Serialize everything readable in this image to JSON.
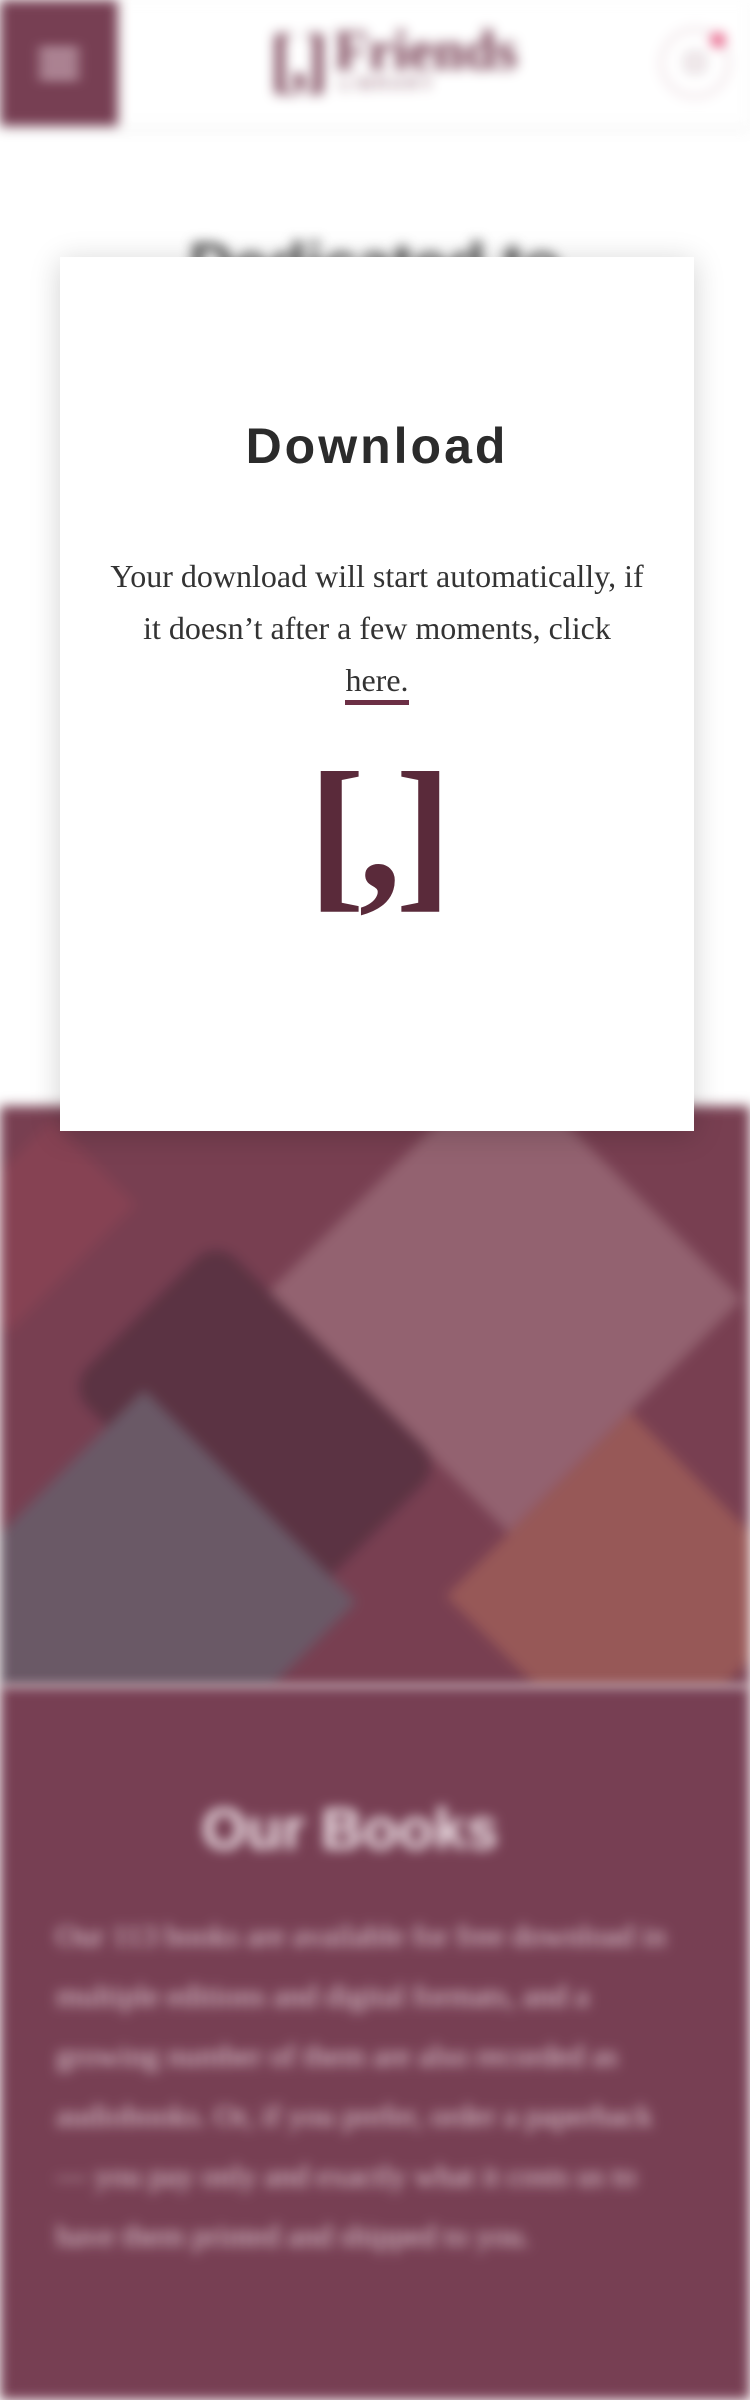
{
  "header": {
    "logo_mark": "[,]",
    "logo_name": "Friends",
    "logo_sub": "LIBRARY"
  },
  "background": {
    "partial_title": "Dedicated to the"
  },
  "modal": {
    "title": "Download",
    "message": "Your download will start automatically, if it doesn’t after a few moments, click",
    "link_text": "here.",
    "logo_mark": "[,]"
  },
  "our_books": {
    "heading": "Our Books",
    "body": "Our 113 books are available for free download in multiple editions and digital formats, and a growing number of them are also recorded as audiobooks. Or, if you prefer, order a paperback — you pay only and exactly what it costs us to have them printed and shipped to you."
  },
  "colors": {
    "brand": "#6c2f45",
    "cart_badge": "#e23a6a"
  },
  "icons": {
    "menu": "hamburger-menu-icon",
    "cart": "shopping-bag-icon"
  }
}
